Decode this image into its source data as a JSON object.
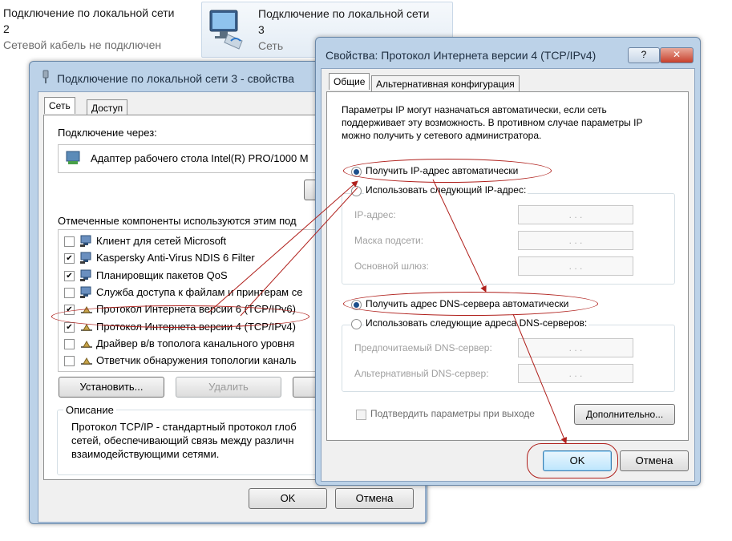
{
  "tiles": [
    {
      "title": "Подключение по локальной сети",
      "number": "2",
      "status": "Сетевой кабель не подключен"
    },
    {
      "title": "Подключение по локальной сети",
      "number": "3",
      "status": "Сеть"
    }
  ],
  "props_window": {
    "title": "Подключение по локальной сети 3 - свойства",
    "tabs": [
      "Сеть",
      "Доступ"
    ],
    "connect_via_label": "Подключение через:",
    "adapter": "Адаптер рабочего стола Intel(R) PRO/1000 M",
    "components_label": "Отмеченные компоненты используются этим под",
    "components": [
      {
        "label": "Клиент для сетей Microsoft",
        "checked": false
      },
      {
        "label": "Kaspersky Anti-Virus NDIS 6 Filter",
        "checked": true
      },
      {
        "label": "Планировщик пакетов QoS",
        "checked": true
      },
      {
        "label": "Служба доступа к файлам и принтерам се",
        "checked": false
      },
      {
        "label": "Протокол Интернета версии 6 (TCP/IPv6)",
        "checked": true
      },
      {
        "label": "Протокол Интернета версии 4 (TCP/IPv4)",
        "checked": true
      },
      {
        "label": "Драйвер в/в тополога канального уровня",
        "checked": false
      },
      {
        "label": "Ответчик обнаружения топологии каналь",
        "checked": false
      }
    ],
    "install_button": "Установить...",
    "remove_button": "Удалить",
    "description_label": "Описание",
    "description": "Протокол TCP/IP - стандартный протокол глоб сетей, обеспечивающий связь между различн взаимодействующими сетями.",
    "ok_button": "OK",
    "cancel_button": "Отмена"
  },
  "ipv4_dialog": {
    "title": "Свойства: Протокол Интернета версии 4 (TCP/IPv4)",
    "help_button": "?",
    "close_button": "✕",
    "tabs": [
      "Общие",
      "Альтернативная конфигурация"
    ],
    "intro": "Параметры IP могут назначаться автоматически, если сеть поддерживает эту возможность. В противном случае параметры IP можно получить у сетевого администратора.",
    "radio_ip_auto": "Получить IP-адрес автоматически",
    "radio_ip_manual": "Использовать следующий IP-адрес:",
    "ip_label": "IP-адрес:",
    "mask_label": "Маска подсети:",
    "gateway_label": "Основной шлюз:",
    "radio_dns_auto": "Получить адрес DNS-сервера автоматически",
    "radio_dns_manual": "Использовать следующие адреса DNS-серверов:",
    "dns_pref_label": "Предпочитаемый DNS-сервер:",
    "dns_alt_label": "Альтернативный DNS-сервер:",
    "ip_placeholder": ".   .   .",
    "validate_label": "Подтвердить параметры при выходе",
    "advanced_button": "Дополнительно...",
    "ok_button": "OK",
    "cancel_button": "Отмена",
    "ip_auto_selected": true,
    "dns_auto_selected": true
  },
  "colors": {
    "annotation": "#b0201c",
    "accent": "#1b4f8c"
  }
}
